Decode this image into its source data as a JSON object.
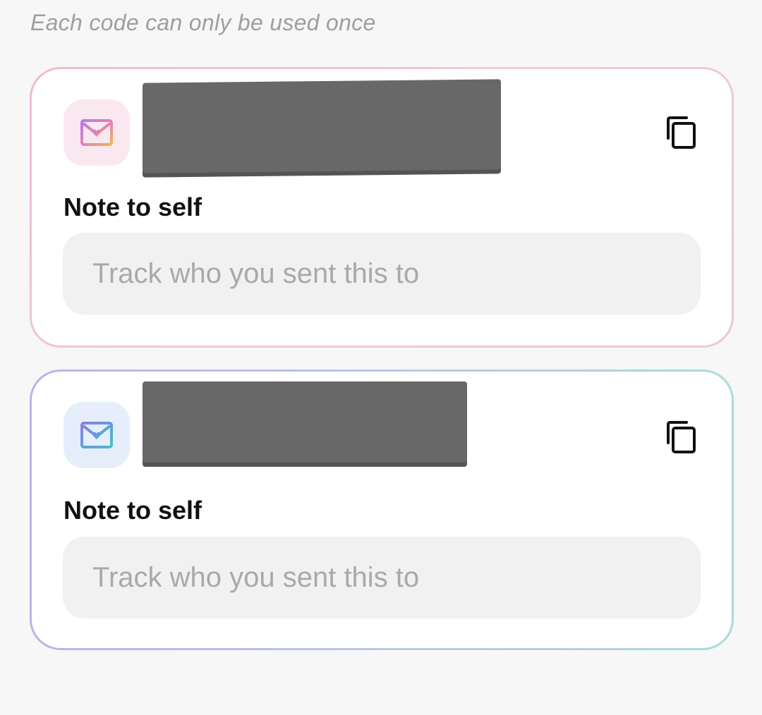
{
  "hint": "Each code can only be used once",
  "codes": [
    {
      "note_label": "Note to self",
      "note_placeholder": "Track who you sent this to",
      "note_value": "",
      "icon": "envelope-heart-icon",
      "accent_colors": [
        "#eebbd8",
        "#f0c9dd"
      ]
    },
    {
      "note_label": "Note to self",
      "note_placeholder": "Track who you sent this to",
      "note_value": "",
      "icon": "envelope-heart-icon",
      "accent_colors": [
        "#b9b4ec",
        "#a9dcd8"
      ]
    }
  ],
  "icons": {
    "copy": "copy-icon"
  }
}
